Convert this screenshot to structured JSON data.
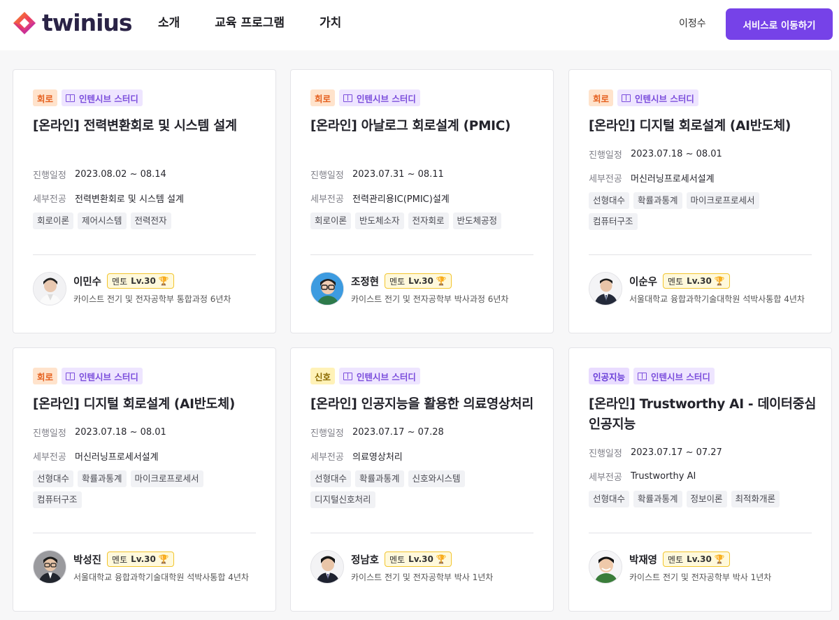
{
  "header": {
    "logo_text": "twinius",
    "nav": [
      "소개",
      "교육 프로그램",
      "가치"
    ],
    "user_name": "이정수",
    "cta_label": "서비스로 이동하기"
  },
  "colors": {
    "brand_purple": "#7642e8",
    "tag_orange": "#e5601e",
    "tag_yellow": "#8b6a00",
    "tag_purple": "#6a3fd8"
  },
  "labels": {
    "schedule": "진행일정",
    "major": "세부전공"
  },
  "cards": [
    {
      "category": "회로",
      "type": "인텐시브 스터디",
      "title": "[온라인] 전력변환회로 및 시스템 설계",
      "schedule": "2023.08.02 ~ 08.14",
      "major": "전력변환회로 및 시스템 설계",
      "keywords": [
        "회로이론",
        "제어시스템",
        "전력전자"
      ],
      "mentor": {
        "name": "이민수",
        "role": "멘토",
        "level": "Lv.30",
        "affiliation": "카이스트  전기 및 전자공학부 통합과정 6년차"
      }
    },
    {
      "category": "회로",
      "type": "인텐시브 스터디",
      "title": "[온라인] 아날로그 회로설계 (PMIC)",
      "schedule": "2023.07.31 ~ 08.11",
      "major": "전력관리용IC(PMIC)설계",
      "keywords": [
        "회로이론",
        "반도체소자",
        "전자회로",
        "반도체공정"
      ],
      "mentor": {
        "name": "조정현",
        "role": "멘토",
        "level": "Lv.30",
        "affiliation": "카이스트  전기 및 전자공학부 박사과정 6년차"
      }
    },
    {
      "category": "회로",
      "type": "인텐시브 스터디",
      "title": "[온라인] 디지털 회로설계 (AI반도체)",
      "schedule": "2023.07.18 ~ 08.01",
      "major": "머신러닝프로세서설계",
      "keywords": [
        "선형대수",
        "확률과통계",
        "마이크로프로세서",
        "컴퓨터구조"
      ],
      "mentor": {
        "name": "이순우",
        "role": "멘토",
        "level": "Lv.30",
        "affiliation": "서울대학교  융합과학기술대학원 석박사통합 4년차"
      }
    },
    {
      "category": "회로",
      "type": "인텐시브 스터디",
      "title": "[온라인] 디지털 회로설계 (AI반도체)",
      "schedule": "2023.07.18 ~ 08.01",
      "major": "머신러닝프로세서설계",
      "keywords": [
        "선형대수",
        "확률과통계",
        "마이크로프로세서",
        "컴퓨터구조"
      ],
      "mentor": {
        "name": "박성진",
        "role": "멘토",
        "level": "Lv.30",
        "affiliation": "서울대학교  융합과학기술대학원 석박사통합 4년차"
      }
    },
    {
      "category": "신호",
      "type": "인텐시브 스터디",
      "title": "[온라인] 인공지능을 활용한 의료영상처리",
      "schedule": "2023.07.17 ~ 07.28",
      "major": "의료영상처리",
      "keywords": [
        "선형대수",
        "확률과통계",
        "신호와시스템",
        "디지털신호처리"
      ],
      "mentor": {
        "name": "정남호",
        "role": "멘토",
        "level": "Lv.30",
        "affiliation": "카이스트  전기 및 전자공학부 박사 1년차"
      }
    },
    {
      "category": "인공지능",
      "type": "인텐시브 스터디",
      "title": "[온라인] Trustworthy AI - 데이터중심 인공지능",
      "schedule": "2023.07.17 ~ 07.27",
      "major": "Trustworthy AI",
      "keywords": [
        "선형대수",
        "확률과통계",
        "정보이론",
        "최적화개론"
      ],
      "mentor": {
        "name": "박재영",
        "role": "멘토",
        "level": "Lv.30",
        "affiliation": "카이스트  전기 및 전자공학부 박사 1년차"
      }
    }
  ]
}
